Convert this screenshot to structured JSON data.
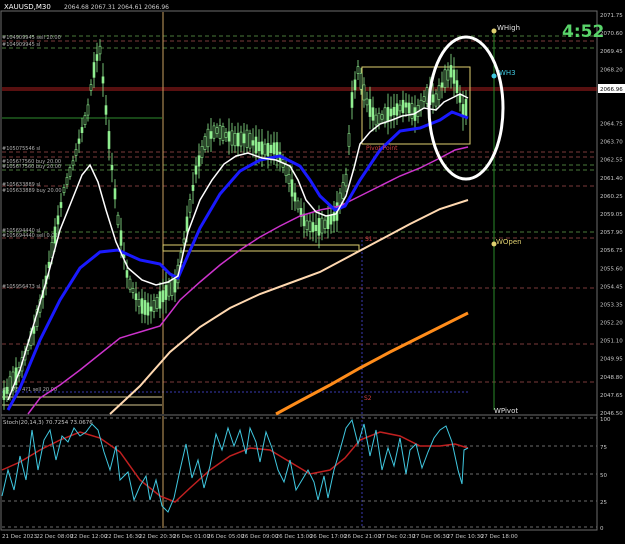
{
  "header": {
    "symbol": "XAUUSD,M30",
    "ohlc": "2064.68 2067.31 2064.61 2066.96"
  },
  "timer": "4:52",
  "current_price": "2066.96",
  "price_scale": [
    "2071.75",
    "2070.60",
    "2069.45",
    "2068.20",
    "2067.05",
    "2066.96",
    "2064.75",
    "2063.70",
    "2062.55",
    "2061.40",
    "2060.25",
    "2059.05",
    "2057.90",
    "2056.75",
    "2055.60",
    "2054.45",
    "2053.35",
    "2052.20",
    "2051.10",
    "2049.95",
    "2048.80",
    "2047.65",
    "2046.50"
  ],
  "time_scale": [
    "21 Dec 2023",
    "22 Dec 08:00",
    "22 Dec 12:00",
    "22 Dec 16:30",
    "22 Dec 20:30",
    "26 Dec 01:00",
    "26 Dec 05:00",
    "26 Dec 09:00",
    "26 Dec 13:00",
    "26 Dec 17:00",
    "26 Dec 21:00",
    "27 Dec 02:30",
    "27 Dec 06:30",
    "27 Dec 10:30",
    "27 Dec 18:00"
  ],
  "level_labels": [
    "WHigh",
    "WH3",
    "WOpen",
    "WPivot",
    "Pivot Point",
    "S1",
    "S2"
  ],
  "order_labels": [
    "#104909945 sell 20.00",
    "#104909945 sl",
    "#105075546 sl",
    "#1056?7560 buy 20.00",
    "#1056?7560 buy 20.00",
    "#105633889 sl",
    "#105633889 buy 20.00",
    "#105694440 sl",
    "#105694440 sell 0.00",
    "#105956473 sl",
    "#107574?1 sell 20.00"
  ],
  "oscillator": {
    "label": "Stoch(20,14,3) 70.7254 73.0676",
    "levels": [
      "100",
      "75",
      "50",
      "25",
      "0"
    ]
  },
  "colors": {
    "candles": "#90ee90",
    "ma_fast": "#ffffff",
    "ma_blue": "#1a1aff",
    "ma_magenta": "#cc33cc",
    "ma_peach": "#ffd8b0",
    "ma_orange": "#ff8c1a",
    "osc_main": "#40c8e0",
    "osc_signal": "#c02020",
    "timer": "#59d46a"
  }
}
